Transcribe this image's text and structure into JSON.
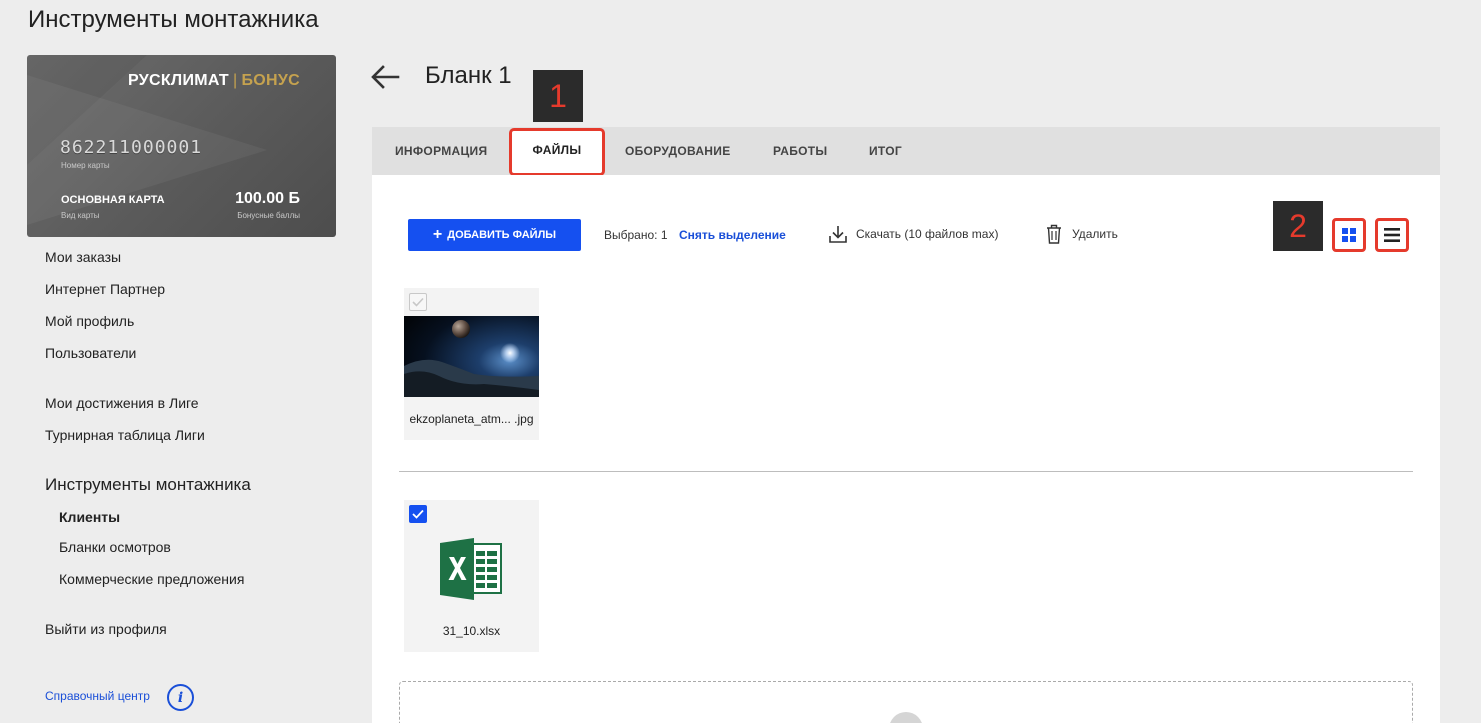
{
  "app": {
    "title": "Инструменты монтажника"
  },
  "card": {
    "brand": "РУСКЛИМАТ",
    "brand_sep": "|",
    "brand_bonus": "БОНУС",
    "number": "862211000001",
    "number_label": "Номер карты",
    "type": "ОСНОВНАЯ КАРТА",
    "type_label": "Вид карты",
    "points": "100.00 Б",
    "points_label": "Бонусные баллы"
  },
  "sidebar": {
    "items": [
      {
        "label": "Мои заказы"
      },
      {
        "label": "Интернет Партнер"
      },
      {
        "label": "Мой профиль"
      },
      {
        "label": "Пользователи"
      },
      {
        "label": "Мои достижения в Лиге"
      },
      {
        "label": "Турнирная таблица Лиги"
      }
    ],
    "section_title": "Инструменты монтажника",
    "sub_items": [
      {
        "label": "Клиенты",
        "active": true
      },
      {
        "label": "Бланки осмотров"
      },
      {
        "label": "Коммерческие предложения"
      }
    ],
    "logout": "Выйти из профиля",
    "help": "Справочный центр",
    "help_icon": "info-icon"
  },
  "header": {
    "title": "Бланк 1"
  },
  "callouts": {
    "one": "1",
    "two": "2"
  },
  "tabs": [
    {
      "label": "ИНФОРМАЦИЯ"
    },
    {
      "label": "ФАЙЛЫ",
      "active": true
    },
    {
      "label": "ОБОРУДОВАНИЕ"
    },
    {
      "label": "РАБОТЫ"
    },
    {
      "label": "ИТОГ"
    }
  ],
  "toolbar": {
    "add_label": "ДОБАВИТЬ ФАЙЛЫ",
    "selected": "Выбрано: 1",
    "deselect": "Снять выделение",
    "download": "Скачать (10 файлов max)",
    "delete": "Удалить"
  },
  "files": [
    {
      "name": "ekzoplaneta_atm... .jpg",
      "checked": false
    },
    {
      "name": "31_10.xlsx",
      "checked": true
    }
  ],
  "colors": {
    "accent": "#1550f0",
    "highlight": "#e53a2c",
    "excel": "#1e7145"
  }
}
